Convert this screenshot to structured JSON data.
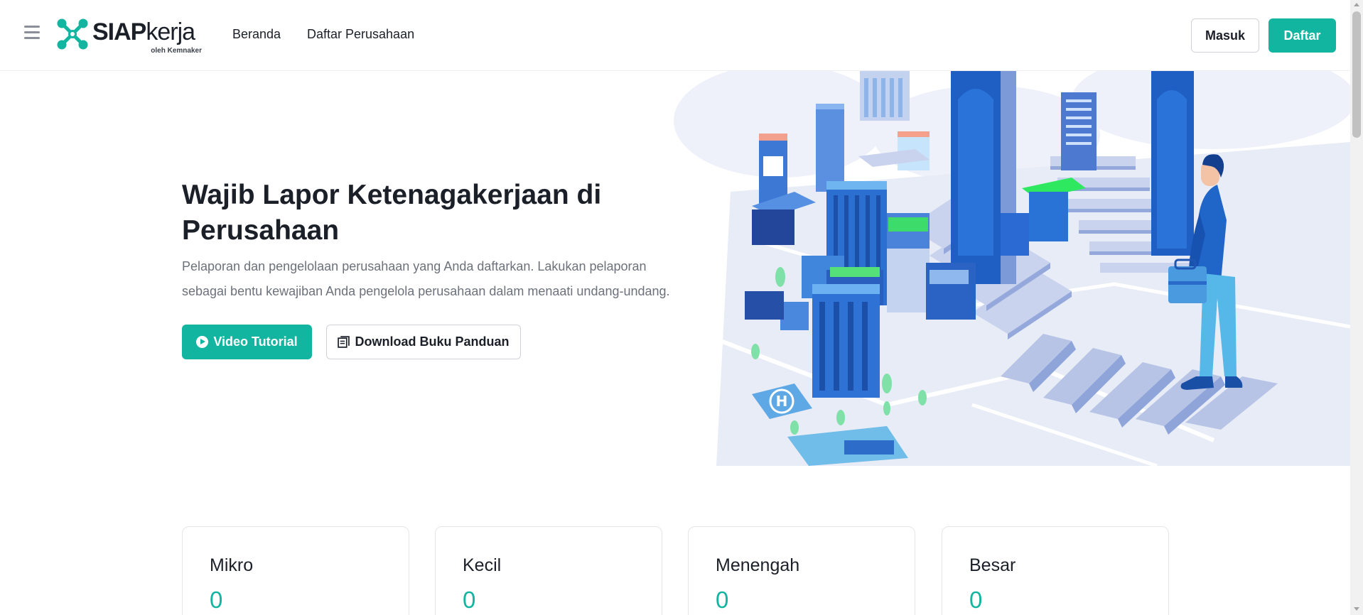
{
  "brand": {
    "name_bold": "SIAP",
    "name_light": "kerja",
    "tagline": "oleh Kemnaker",
    "accent_color": "#12b5a0"
  },
  "nav": {
    "menu_icon": "hamburger-icon",
    "links": [
      {
        "label": "Beranda"
      },
      {
        "label": "Daftar Perusahaan"
      }
    ],
    "login_label": "Masuk",
    "register_label": "Daftar"
  },
  "hero": {
    "title": "Wajib Lapor Ketenagakerjaan di Perusahaan",
    "description": "Pelaporan dan pengelolaan perusahaan yang Anda daftarkan. Lakukan pelaporan sebagai bentu kewajiban Anda pengelola perusahaan dalam menaati undang-undang.",
    "video_button": {
      "label": "Video Tutorial",
      "icon": "play-circle-icon"
    },
    "download_button": {
      "label": "Download Buku Panduan",
      "icon": "book-icon"
    },
    "helipad_letter": "H"
  },
  "stats": [
    {
      "label": "Mikro",
      "value": "0"
    },
    {
      "label": "Kecil",
      "value": "0"
    },
    {
      "label": "Menengah",
      "value": "0"
    },
    {
      "label": "Besar",
      "value": "0"
    }
  ]
}
